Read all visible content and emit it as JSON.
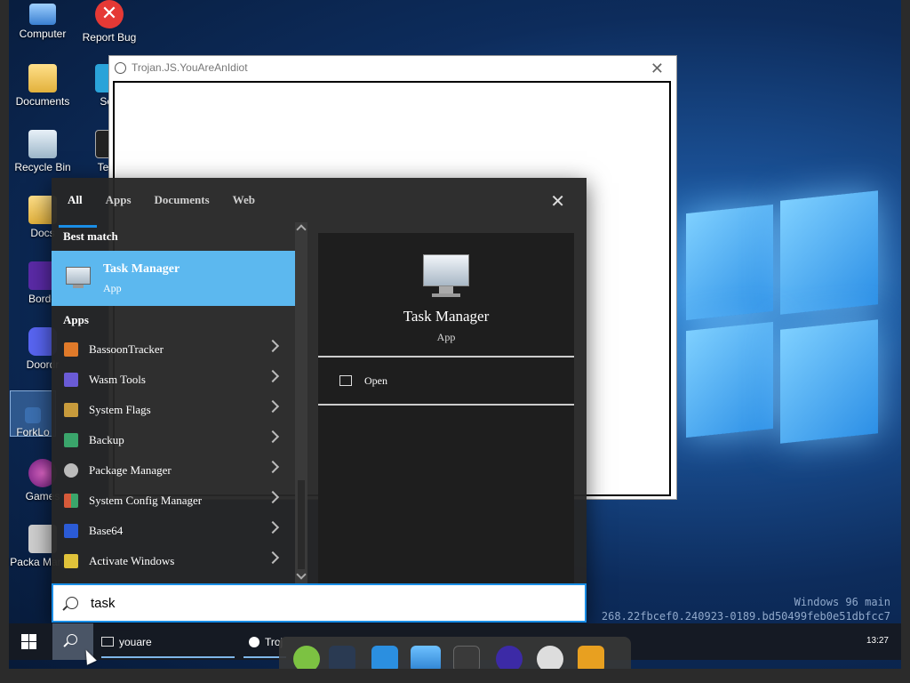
{
  "desktop": {
    "icons": [
      {
        "label": "Computer",
        "icon": "computer-icon"
      },
      {
        "label": "Report Bug",
        "icon": "report-bug-icon"
      },
      {
        "label": "Documents",
        "icon": "documents-icon"
      },
      {
        "label": "Sett",
        "icon": "settings-icon"
      },
      {
        "label": "Recycle Bin",
        "icon": "recycle-bin-icon"
      },
      {
        "label": "Term",
        "icon": "terminal-icon"
      },
      {
        "label": "Docs",
        "icon": "folder-icon"
      },
      {
        "label": "Borde",
        "icon": "borderlands-icon"
      },
      {
        "label": "Doordr",
        "icon": "discord-icon"
      },
      {
        "label": "ForkLo",
        "icon": "forklo-icon"
      },
      {
        "label": "Games",
        "icon": "games-icon"
      },
      {
        "label": "Packa Manag",
        "icon": "package-manager-icon"
      }
    ],
    "watermark_line1": "Windows 96 main",
    "watermark_line2": "268.22fbcef0.240923-0189.bd50499feb0e51dbfcc7"
  },
  "trojan_window": {
    "title": "Trojan.JS.YouAreAnIdiot"
  },
  "search_panel": {
    "tabs": [
      "All",
      "Apps",
      "Documents",
      "Web"
    ],
    "active_tab": "All",
    "best_match_header": "Best match",
    "best_match": {
      "title": "Task Manager",
      "subtitle": "App"
    },
    "apps_header": "Apps",
    "apps": [
      {
        "label": "BassoonTracker",
        "color": "#e07a2a"
      },
      {
        "label": "Wasm Tools",
        "color": "#6a5bd6"
      },
      {
        "label": "System Flags",
        "color": "#c89b3c"
      },
      {
        "label": "Backup",
        "color": "#3aa56b"
      },
      {
        "label": "Package Manager",
        "color": "#bbbbbb"
      },
      {
        "label": "System Config Manager",
        "color": "#d65a3a"
      },
      {
        "label": "Base64",
        "color": "#2b5bd6"
      },
      {
        "label": "Activate Windows",
        "color": "#e0c23a"
      }
    ],
    "preview": {
      "title": "Task Manager",
      "type": "App",
      "action": "Open"
    },
    "query": "task"
  },
  "taskbar": {
    "tasks": [
      "youare",
      "Troj"
    ],
    "clock": "13:27"
  },
  "dock": {
    "apps": [
      "linux-mint-icon",
      "settings-sliders-icon",
      "store-icon",
      "files-icon",
      "terminal-icon",
      "fluxbox-icon",
      "inkscape-icon",
      "winamp-icon"
    ]
  },
  "colors": {
    "accent": "#1a8ee6",
    "best_match_bg": "#5cb8ef"
  }
}
